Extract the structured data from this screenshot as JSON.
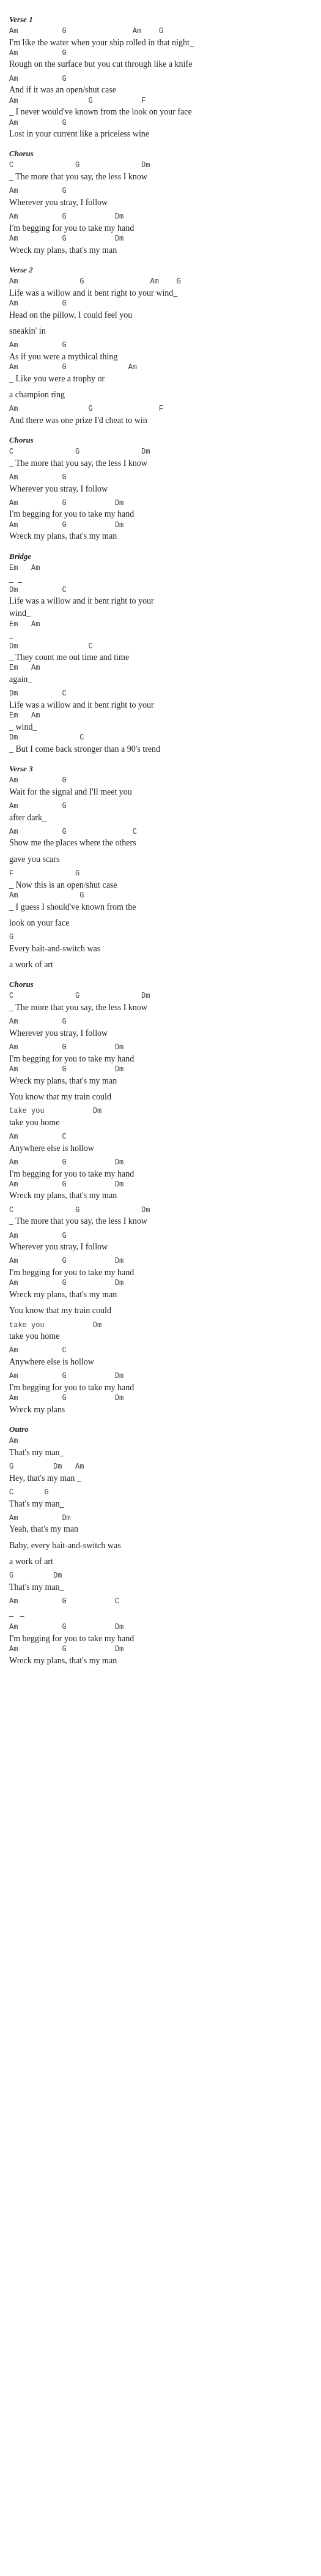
{
  "sections": [
    {
      "label": "Verse 1",
      "lines": [
        {
          "type": "chord",
          "text": "Am          G               Am    G"
        },
        {
          "type": "lyric",
          "text": "I'm like the water when your ship rolled in that night_"
        },
        {
          "type": "chord",
          "text": "Am          G"
        },
        {
          "type": "lyric",
          "text": "Rough on the surface but you cut through like a knife"
        },
        {
          "type": "blank"
        },
        {
          "type": "chord",
          "text": "Am          G"
        },
        {
          "type": "lyric",
          "text": "And if it was an open/shut case"
        },
        {
          "type": "chord",
          "text": "Am                G           F"
        },
        {
          "type": "lyric",
          "text": "_ I never would've known from the look on your face"
        },
        {
          "type": "chord",
          "text": "Am          G"
        },
        {
          "type": "lyric",
          "text": "Lost in your current like a priceless wine"
        }
      ]
    },
    {
      "label": "Chorus",
      "lines": [
        {
          "type": "chord",
          "text": "C              G              Dm"
        },
        {
          "type": "lyric",
          "text": "_ The more that you say, the less I know"
        },
        {
          "type": "blank"
        },
        {
          "type": "chord",
          "text": "Am          G"
        },
        {
          "type": "lyric",
          "text": "Wherever you stray, I follow"
        },
        {
          "type": "blank"
        },
        {
          "type": "chord",
          "text": "Am          G           Dm"
        },
        {
          "type": "lyric",
          "text": "I'm begging for you to take my hand"
        },
        {
          "type": "chord",
          "text": "Am          G           Dm"
        },
        {
          "type": "lyric",
          "text": "Wreck my plans, that's my man"
        }
      ]
    },
    {
      "label": "Verse 2",
      "lines": [
        {
          "type": "chord",
          "text": "Am              G               Am    G"
        },
        {
          "type": "lyric",
          "text": "Life was a willow and it bent right to your wind_"
        },
        {
          "type": "chord",
          "text": "Am          G"
        },
        {
          "type": "lyric",
          "text": "Head on the pillow, I could feel you"
        },
        {
          "type": "blank"
        },
        {
          "type": "lyric",
          "text": "sneakin' in"
        },
        {
          "type": "blank"
        },
        {
          "type": "chord",
          "text": "Am          G"
        },
        {
          "type": "lyric",
          "text": "As if you were a mythical thing"
        },
        {
          "type": "chord",
          "text": "Am          G              Am"
        },
        {
          "type": "lyric",
          "text": "_ Like you were a trophy or"
        },
        {
          "type": "blank"
        },
        {
          "type": "lyric",
          "text": "a champion ring"
        },
        {
          "type": "blank"
        },
        {
          "type": "chord",
          "text": "Am                G               F"
        },
        {
          "type": "lyric",
          "text": "And there was one prize I'd cheat to win"
        }
      ]
    },
    {
      "label": "Chorus",
      "lines": [
        {
          "type": "chord",
          "text": "C              G              Dm"
        },
        {
          "type": "lyric",
          "text": "_ The more that you say, the less I know"
        },
        {
          "type": "blank"
        },
        {
          "type": "chord",
          "text": "Am          G"
        },
        {
          "type": "lyric",
          "text": "Wherever you stray, I follow"
        },
        {
          "type": "blank"
        },
        {
          "type": "chord",
          "text": "Am          G           Dm"
        },
        {
          "type": "lyric",
          "text": "I'm begging for you to take my hand"
        },
        {
          "type": "chord",
          "text": "Am          G           Dm"
        },
        {
          "type": "lyric",
          "text": "Wreck my plans, that's my man"
        }
      ]
    },
    {
      "label": "Bridge",
      "lines": [
        {
          "type": "chord",
          "text": "Em   Am"
        },
        {
          "type": "lyric",
          "text": "_  _"
        },
        {
          "type": "chord",
          "text": "Dm          C"
        },
        {
          "type": "lyric",
          "text": "Life was a willow and it bent right to your"
        },
        {
          "type": "lyric",
          "text": "wind_"
        },
        {
          "type": "chord",
          "text": "Em   Am"
        },
        {
          "type": "lyric",
          "text": "_"
        },
        {
          "type": "chord",
          "text": "Dm                C"
        },
        {
          "type": "lyric",
          "text": "_ They count me out time and time"
        },
        {
          "type": "chord",
          "text": "Em   Am"
        },
        {
          "type": "lyric",
          "text": "again_"
        },
        {
          "type": "blank"
        },
        {
          "type": "chord",
          "text": "Dm          C"
        },
        {
          "type": "lyric",
          "text": "Life was a willow and it bent right to your"
        },
        {
          "type": "chord",
          "text": "Em   Am"
        },
        {
          "type": "lyric",
          "text": "_ wind_"
        },
        {
          "type": "chord",
          "text": "Dm              C"
        },
        {
          "type": "lyric",
          "text": "_ But I come back stronger than a 90's trend"
        }
      ]
    },
    {
      "label": "Verse 3",
      "lines": [
        {
          "type": "chord",
          "text": "Am          G"
        },
        {
          "type": "lyric",
          "text": "Wait for the signal and I'll meet you"
        },
        {
          "type": "blank"
        },
        {
          "type": "chord",
          "text": "Am          G"
        },
        {
          "type": "lyric",
          "text": "after dark_"
        },
        {
          "type": "blank"
        },
        {
          "type": "chord",
          "text": "Am          G               C"
        },
        {
          "type": "lyric",
          "text": "Show me the places where the others"
        },
        {
          "type": "blank"
        },
        {
          "type": "lyric",
          "text": "gave you scars"
        },
        {
          "type": "blank"
        },
        {
          "type": "chord",
          "text": "F              G"
        },
        {
          "type": "lyric",
          "text": "_ Now this is an open/shut case"
        },
        {
          "type": "chord",
          "text": "Am              G"
        },
        {
          "type": "lyric",
          "text": "_ I guess I should've known from the"
        },
        {
          "type": "blank"
        },
        {
          "type": "lyric",
          "text": "look on your face"
        },
        {
          "type": "blank"
        },
        {
          "type": "chord",
          "text": "G"
        },
        {
          "type": "lyric",
          "text": "Every bait-and-switch was"
        },
        {
          "type": "blank"
        },
        {
          "type": "lyric",
          "text": "a work of art"
        }
      ]
    },
    {
      "label": "Chorus",
      "lines": [
        {
          "type": "chord",
          "text": "C              G              Dm"
        },
        {
          "type": "lyric",
          "text": "_ The more that you say, the less I know"
        },
        {
          "type": "blank"
        },
        {
          "type": "chord",
          "text": "Am          G"
        },
        {
          "type": "lyric",
          "text": "Wherever you stray, I follow"
        },
        {
          "type": "blank"
        },
        {
          "type": "chord",
          "text": "Am          G           Dm"
        },
        {
          "type": "lyric",
          "text": "I'm begging for you to take my hand"
        },
        {
          "type": "chord",
          "text": "Am          G           Dm"
        },
        {
          "type": "lyric",
          "text": "Wreck my plans, that's my man"
        },
        {
          "type": "blank"
        },
        {
          "type": "lyric",
          "text": "You know that my train could"
        },
        {
          "type": "blank"
        },
        {
          "type": "chord",
          "text": "take you           Dm"
        },
        {
          "type": "lyric",
          "text": "take you home"
        },
        {
          "type": "blank"
        },
        {
          "type": "chord",
          "text": "Am          C"
        },
        {
          "type": "lyric",
          "text": "Anywhere else is hollow"
        },
        {
          "type": "blank"
        },
        {
          "type": "chord",
          "text": "Am          G           Dm"
        },
        {
          "type": "lyric",
          "text": "I'm begging for you to take my hand"
        },
        {
          "type": "chord",
          "text": "Am          G           Dm"
        },
        {
          "type": "lyric",
          "text": "Wreck my plans, that's my man"
        },
        {
          "type": "blank"
        },
        {
          "type": "chord",
          "text": "C              G              Dm"
        },
        {
          "type": "lyric",
          "text": "_ The more that you say, the less I know"
        },
        {
          "type": "blank"
        },
        {
          "type": "chord",
          "text": "Am          G"
        },
        {
          "type": "lyric",
          "text": "Wherever you stray, I follow"
        },
        {
          "type": "blank"
        },
        {
          "type": "chord",
          "text": "Am          G           Dm"
        },
        {
          "type": "lyric",
          "text": "I'm begging for you to take my hand"
        },
        {
          "type": "chord",
          "text": "Am          G           Dm"
        },
        {
          "type": "lyric",
          "text": "Wreck my plans, that's my man"
        },
        {
          "type": "blank"
        },
        {
          "type": "lyric",
          "text": "You know that my train could"
        },
        {
          "type": "blank"
        },
        {
          "type": "chord",
          "text": "take you           Dm"
        },
        {
          "type": "lyric",
          "text": "take you home"
        },
        {
          "type": "blank"
        },
        {
          "type": "chord",
          "text": "Am          C"
        },
        {
          "type": "lyric",
          "text": "Anywhere else is hollow"
        },
        {
          "type": "blank"
        },
        {
          "type": "chord",
          "text": "Am          G           Dm"
        },
        {
          "type": "lyric",
          "text": "I'm begging for you to take my hand"
        },
        {
          "type": "chord",
          "text": "Am          G           Dm"
        },
        {
          "type": "lyric",
          "text": "Wreck my plans"
        }
      ]
    },
    {
      "label": "Outro",
      "lines": [
        {
          "type": "chord",
          "text": "Am"
        },
        {
          "type": "lyric",
          "text": "That's my man_"
        },
        {
          "type": "blank"
        },
        {
          "type": "chord",
          "text": "G         Dm   Am"
        },
        {
          "type": "lyric",
          "text": "Hey, that's my man _"
        },
        {
          "type": "blank"
        },
        {
          "type": "chord",
          "text": "C       G"
        },
        {
          "type": "lyric",
          "text": "That's my man_"
        },
        {
          "type": "blank"
        },
        {
          "type": "chord",
          "text": "Am          Dm"
        },
        {
          "type": "lyric",
          "text": "Yeah, that's my man"
        },
        {
          "type": "blank"
        },
        {
          "type": "lyric",
          "text": "Baby, every bait-and-switch was"
        },
        {
          "type": "blank"
        },
        {
          "type": "lyric",
          "text": "a work of art"
        },
        {
          "type": "blank"
        },
        {
          "type": "chord",
          "text": "G         Dm"
        },
        {
          "type": "lyric",
          "text": "That's my man_"
        },
        {
          "type": "blank"
        },
        {
          "type": "chord",
          "text": "Am          G           C"
        },
        {
          "type": "lyric",
          "text": "_   _"
        },
        {
          "type": "blank"
        },
        {
          "type": "chord",
          "text": "Am          G           Dm"
        },
        {
          "type": "lyric",
          "text": "I'm begging for you to take my hand"
        },
        {
          "type": "chord",
          "text": "Am          G           Dm"
        },
        {
          "type": "lyric",
          "text": "Wreck my plans, that's my man"
        }
      ]
    }
  ]
}
